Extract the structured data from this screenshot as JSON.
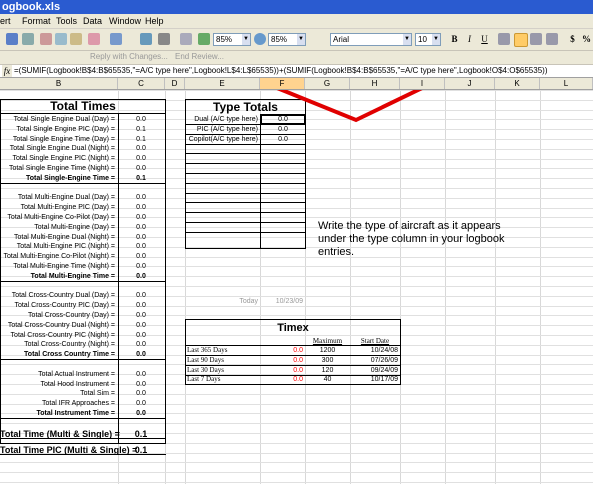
{
  "window": {
    "title": "ogbook.xls"
  },
  "menu": [
    "ert",
    "Format",
    "Tools",
    "Data",
    "Window",
    "Help"
  ],
  "toolbar": {
    "zoom1": "85%",
    "zoom2": "85%",
    "font": "Arial",
    "font_size": "10",
    "bold": "B",
    "italic": "I",
    "underline": "U",
    "currency": "$",
    "percent": "%"
  },
  "review_bar": {
    "reply": "Reply with Changes...",
    "end_review": "End Review..."
  },
  "formula_bar": {
    "fx": "fx",
    "formula": "=(SUMIF(Logbook!B$4:B$65535,\"=A/C type here\",Logbook!L$4:L$65535))+(SUMIF(Logbook!B$4:B$65535,\"=A/C type here\",Logbook!O$4:O$65535))"
  },
  "columns": [
    "B",
    "C",
    "D",
    "E",
    "F",
    "G",
    "H",
    "I",
    "J",
    "K",
    "L"
  ],
  "total_times": {
    "title": "Total Times",
    "single_engine": [
      {
        "label": "Total Single Engine Dual (Day) =",
        "value": "0.0"
      },
      {
        "label": "Total Single Engine PIC (Day) =",
        "value": "0.1"
      },
      {
        "label": "Total Single Engine Time (Day) =",
        "value": "0.1"
      },
      {
        "label": "Total Single Engine Dual (Night) =",
        "value": "0.0"
      },
      {
        "label": "Total Single Engine PIC (Night) =",
        "value": "0.0"
      },
      {
        "label": "Total Single Engine Time (Night) =",
        "value": "0.0"
      }
    ],
    "single_total": {
      "label": "Total Single-Engine Time =",
      "value": "0.1"
    },
    "multi_engine": [
      {
        "label": "Total Multi-Engine Dual (Day) =",
        "value": "0.0"
      },
      {
        "label": "Total Multi-Engine PIC (Day) =",
        "value": "0.0"
      },
      {
        "label": "Total Multi-Engine Co-Pilot (Day) =",
        "value": "0.0"
      },
      {
        "label": "Total Multi-Engine (Day) =",
        "value": "0.0"
      },
      {
        "label": "Total Multi-Engine Dual (Night) =",
        "value": "0.0"
      },
      {
        "label": "Total Multi-Engine PIC (Night) =",
        "value": "0.0"
      },
      {
        "label": "Total Multi-Engine Co-Pilot (Night) =",
        "value": "0.0"
      },
      {
        "label": "Total Multi-Engine Time (Night) =",
        "value": "0.0"
      }
    ],
    "multi_total": {
      "label": "Total Multi-Engine Time =",
      "value": "0.0"
    },
    "cross_country": [
      {
        "label": "Total Cross-Country Dual (Day) =",
        "value": "0.0"
      },
      {
        "label": "Total Cross-Country PIC (Day) =",
        "value": "0.0"
      },
      {
        "label": "Total Cross-Country (Day) =",
        "value": "0.0"
      },
      {
        "label": "Total Cross-Country Dual (Night) =",
        "value": "0.0"
      },
      {
        "label": "Total Cross-Country PIC (Night) =",
        "value": "0.0"
      },
      {
        "label": "Total Cross-Country (Night) =",
        "value": "0.0"
      }
    ],
    "cross_total": {
      "label": "Total Cross Country Time =",
      "value": "0.0"
    },
    "instrument": [
      {
        "label": "Total Actual Instrument =",
        "value": "0.0"
      },
      {
        "label": "Total Hood Instrument =",
        "value": "0.0"
      },
      {
        "label": "Total Sim =",
        "value": "0.0"
      },
      {
        "label": "Total IFR Approaches =",
        "value": "0.0"
      }
    ],
    "instrument_total": {
      "label": "Total Instrument Time =",
      "value": "0.0"
    },
    "grand_total": {
      "label": "Total Time (Multi & Single) =",
      "value": "0.1"
    },
    "grand_pic": {
      "label": "Total Time PIC (Multi & Single) =",
      "value": "0.1"
    }
  },
  "type_totals": {
    "title": "Type Totals",
    "rows": [
      {
        "label": "Dual (A/C type here)",
        "value": "0.0"
      },
      {
        "label": "PIC (A/C type here)",
        "value": "0.0"
      },
      {
        "label": "Copilot(A/C type here)",
        "value": "0.0"
      }
    ]
  },
  "callout": "Write the type of aircraft as it appears under the type column in your logbook entries.",
  "today": {
    "label": "Today",
    "value": "10/23/09"
  },
  "timex": {
    "title": "Timex",
    "headers": [
      "Maximum",
      "Start Date"
    ],
    "rows": [
      {
        "label": "Last 365 Days",
        "value": "0.0",
        "max": "1200",
        "date": "10/24/08"
      },
      {
        "label": "Last 90 Days",
        "value": "0.0",
        "max": "300",
        "date": "07/26/09"
      },
      {
        "label": "Last 30 Days",
        "value": "0.0",
        "max": "120",
        "date": "09/24/09"
      },
      {
        "label": "Last 7 Days",
        "value": "0.0",
        "max": "40",
        "date": "10/17/09"
      }
    ]
  },
  "colors": {
    "arrow": "#e00000",
    "title_bar": "#2a5bd0",
    "chrome": "#ece9d8"
  }
}
